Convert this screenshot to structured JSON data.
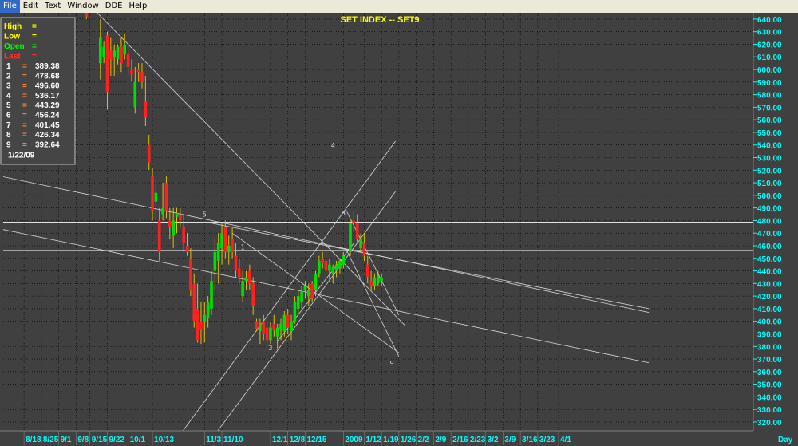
{
  "menu": [
    "File",
    "Edit",
    "Text",
    "Window",
    "DDE",
    "Help"
  ],
  "chart_data": {
    "type": "candlestick",
    "title": "SET  INDEX  --  SET9",
    "info_panel": {
      "rows": [
        {
          "label": "High",
          "sep": "=",
          "value": ""
        },
        {
          "label": "Low",
          "sep": "=",
          "value": ""
        },
        {
          "label": "Open",
          "sep": "=",
          "value": ""
        },
        {
          "label": "Last",
          "sep": "=",
          "value": ""
        }
      ],
      "levels": [
        {
          "n": "1",
          "sep": "=",
          "value": "389.38"
        },
        {
          "n": "2",
          "sep": "=",
          "value": "478.68"
        },
        {
          "n": "3",
          "sep": "=",
          "value": "496.60"
        },
        {
          "n": "4",
          "sep": "=",
          "value": "536.17"
        },
        {
          "n": "5",
          "sep": "=",
          "value": "443.29"
        },
        {
          "n": "6",
          "sep": "=",
          "value": "456.24"
        },
        {
          "n": "7",
          "sep": "=",
          "value": "401.45"
        },
        {
          "n": "8",
          "sep": "=",
          "value": "426.34"
        },
        {
          "n": "9",
          "sep": "=",
          "value": "392.64"
        }
      ],
      "date": "1/22/09"
    },
    "yaxis": {
      "min": 313,
      "max": 645,
      "ticks": [
        320,
        330,
        340,
        350,
        360,
        370,
        380,
        390,
        400,
        410,
        420,
        430,
        440,
        450,
        460,
        470,
        480,
        490,
        500,
        510,
        520,
        530,
        540,
        550,
        560,
        570,
        580,
        590,
        600,
        610,
        620,
        630,
        640
      ]
    },
    "xaxis_label": "Day",
    "xticks": [
      {
        "label": "8/18",
        "i": 0
      },
      {
        "label": "8/25",
        "i": 5
      },
      {
        "label": "9/1",
        "i": 10
      },
      {
        "label": "9/8",
        "i": 15
      },
      {
        "label": "9/15",
        "i": 19
      },
      {
        "label": "9/22",
        "i": 24
      },
      {
        "label": "10/1",
        "i": 30
      },
      {
        "label": "10/13",
        "i": 37
      },
      {
        "label": "11/3",
        "i": 52
      },
      {
        "label": "11/10",
        "i": 57
      },
      {
        "label": "12/1",
        "i": 71
      },
      {
        "label": "12/8",
        "i": 76
      },
      {
        "label": "12/15",
        "i": 81
      },
      {
        "label": "2009",
        "i": 92
      },
      {
        "label": "1/12",
        "i": 98
      },
      {
        "label": "1/19",
        "i": 103
      },
      {
        "label": "1/26",
        "i": 108
      },
      {
        "label": "2/2",
        "i": 113
      },
      {
        "label": "2/9",
        "i": 118
      },
      {
        "label": "2/16",
        "i": 123
      },
      {
        "label": "2/23",
        "i": 128
      },
      {
        "label": "3/2",
        "i": 133
      },
      {
        "label": "3/9",
        "i": 138
      },
      {
        "label": "3/16",
        "i": 143
      },
      {
        "label": "3/23",
        "i": 148
      },
      {
        "label": "4/1",
        "i": 154
      }
    ],
    "candles": [
      {
        "i": 12,
        "o": 649,
        "h": 651,
        "l": 645,
        "c": 647
      },
      {
        "i": 13,
        "o": 645,
        "h": 650,
        "l": 643,
        "c": 648
      },
      {
        "i": 18,
        "o": 652,
        "h": 656,
        "l": 640,
        "c": 642
      },
      {
        "i": 22,
        "o": 605,
        "h": 640,
        "l": 592,
        "c": 625
      },
      {
        "i": 23,
        "o": 610,
        "h": 622,
        "l": 605,
        "c": 618
      },
      {
        "i": 24,
        "o": 627,
        "h": 630,
        "l": 568,
        "c": 582
      },
      {
        "i": 25,
        "o": 615,
        "h": 625,
        "l": 595,
        "c": 608
      },
      {
        "i": 26,
        "o": 610,
        "h": 620,
        "l": 595,
        "c": 615
      },
      {
        "i": 27,
        "o": 608,
        "h": 620,
        "l": 604,
        "c": 618
      },
      {
        "i": 28,
        "o": 618,
        "h": 625,
        "l": 598,
        "c": 605
      },
      {
        "i": 29,
        "o": 612,
        "h": 628,
        "l": 608,
        "c": 620
      },
      {
        "i": 30,
        "o": 612,
        "h": 620,
        "l": 595,
        "c": 602
      },
      {
        "i": 31,
        "o": 600,
        "h": 608,
        "l": 590,
        "c": 596
      },
      {
        "i": 32,
        "o": 570,
        "h": 602,
        "l": 565,
        "c": 590
      },
      {
        "i": 33,
        "o": 600,
        "h": 605,
        "l": 590,
        "c": 598
      },
      {
        "i": 34,
        "o": 598,
        "h": 605,
        "l": 585,
        "c": 590
      },
      {
        "i": 35,
        "o": 575,
        "h": 595,
        "l": 555,
        "c": 562
      },
      {
        "i": 36,
        "o": 540,
        "h": 548,
        "l": 520,
        "c": 526
      },
      {
        "i": 37,
        "o": 515,
        "h": 522,
        "l": 480,
        "c": 487
      },
      {
        "i": 38,
        "o": 495,
        "h": 512,
        "l": 478,
        "c": 502
      },
      {
        "i": 39,
        "o": 480,
        "h": 490,
        "l": 448,
        "c": 455
      },
      {
        "i": 40,
        "o": 485,
        "h": 510,
        "l": 480,
        "c": 490
      },
      {
        "i": 41,
        "o": 510,
        "h": 515,
        "l": 482,
        "c": 488
      },
      {
        "i": 42,
        "o": 480,
        "h": 490,
        "l": 465,
        "c": 475
      },
      {
        "i": 43,
        "o": 468,
        "h": 490,
        "l": 458,
        "c": 480
      },
      {
        "i": 44,
        "o": 483,
        "h": 490,
        "l": 470,
        "c": 486
      },
      {
        "i": 45,
        "o": 485,
        "h": 490,
        "l": 475,
        "c": 480
      },
      {
        "i": 46,
        "o": 475,
        "h": 485,
        "l": 455,
        "c": 462
      },
      {
        "i": 47,
        "o": 460,
        "h": 470,
        "l": 452,
        "c": 455
      },
      {
        "i": 48,
        "o": 450,
        "h": 458,
        "l": 420,
        "c": 425
      },
      {
        "i": 49,
        "o": 430,
        "h": 438,
        "l": 395,
        "c": 400
      },
      {
        "i": 50,
        "o": 410,
        "h": 430,
        "l": 383,
        "c": 385
      },
      {
        "i": 51,
        "o": 400,
        "h": 415,
        "l": 382,
        "c": 393
      },
      {
        "i": 52,
        "o": 400,
        "h": 415,
        "l": 383,
        "c": 405
      },
      {
        "i": 53,
        "o": 403,
        "h": 420,
        "l": 395,
        "c": 415
      },
      {
        "i": 54,
        "o": 410,
        "h": 440,
        "l": 405,
        "c": 432
      },
      {
        "i": 55,
        "o": 440,
        "h": 465,
        "l": 425,
        "c": 455
      },
      {
        "i": 56,
        "o": 448,
        "h": 470,
        "l": 430,
        "c": 462
      },
      {
        "i": 57,
        "o": 458,
        "h": 478,
        "l": 445,
        "c": 470
      },
      {
        "i": 58,
        "o": 475,
        "h": 480,
        "l": 450,
        "c": 455
      },
      {
        "i": 59,
        "o": 455,
        "h": 468,
        "l": 445,
        "c": 460
      },
      {
        "i": 60,
        "o": 465,
        "h": 475,
        "l": 450,
        "c": 455
      },
      {
        "i": 61,
        "o": 452,
        "h": 462,
        "l": 435,
        "c": 440
      },
      {
        "i": 62,
        "o": 442,
        "h": 450,
        "l": 430,
        "c": 435
      },
      {
        "i": 63,
        "o": 420,
        "h": 440,
        "l": 415,
        "c": 432
      },
      {
        "i": 64,
        "o": 432,
        "h": 440,
        "l": 425,
        "c": 435
      },
      {
        "i": 65,
        "o": 440,
        "h": 445,
        "l": 425,
        "c": 430
      },
      {
        "i": 66,
        "o": 430,
        "h": 435,
        "l": 405,
        "c": 412
      },
      {
        "i": 67,
        "o": 400,
        "h": 402,
        "l": 392,
        "c": 394
      },
      {
        "i": 68,
        "o": 392,
        "h": 402,
        "l": 382,
        "c": 398
      },
      {
        "i": 69,
        "o": 400,
        "h": 405,
        "l": 385,
        "c": 390
      },
      {
        "i": 70,
        "o": 395,
        "h": 400,
        "l": 380,
        "c": 385
      },
      {
        "i": 71,
        "o": 385,
        "h": 400,
        "l": 382,
        "c": 395
      },
      {
        "i": 72,
        "o": 398,
        "h": 405,
        "l": 388,
        "c": 393
      },
      {
        "i": 73,
        "o": 388,
        "h": 398,
        "l": 378,
        "c": 395
      },
      {
        "i": 74,
        "o": 393,
        "h": 402,
        "l": 385,
        "c": 398
      },
      {
        "i": 75,
        "o": 392,
        "h": 408,
        "l": 388,
        "c": 405
      },
      {
        "i": 76,
        "o": 405,
        "h": 410,
        "l": 390,
        "c": 395
      },
      {
        "i": 77,
        "o": 392,
        "h": 405,
        "l": 385,
        "c": 400
      },
      {
        "i": 78,
        "o": 400,
        "h": 420,
        "l": 398,
        "c": 415
      },
      {
        "i": 79,
        "o": 410,
        "h": 425,
        "l": 405,
        "c": 420
      },
      {
        "i": 80,
        "o": 415,
        "h": 428,
        "l": 410,
        "c": 424
      },
      {
        "i": 81,
        "o": 425,
        "h": 432,
        "l": 418,
        "c": 428
      },
      {
        "i": 82,
        "o": 420,
        "h": 430,
        "l": 412,
        "c": 425
      },
      {
        "i": 83,
        "o": 430,
        "h": 432,
        "l": 415,
        "c": 418
      },
      {
        "i": 84,
        "o": 425,
        "h": 440,
        "l": 420,
        "c": 438
      },
      {
        "i": 85,
        "o": 438,
        "h": 452,
        "l": 435,
        "c": 448
      },
      {
        "i": 86,
        "o": 450,
        "h": 455,
        "l": 442,
        "c": 446
      },
      {
        "i": 87,
        "o": 448,
        "h": 456,
        "l": 438,
        "c": 440
      },
      {
        "i": 88,
        "o": 440,
        "h": 450,
        "l": 432,
        "c": 445
      },
      {
        "i": 89,
        "o": 438,
        "h": 445,
        "l": 430,
        "c": 443
      },
      {
        "i": 90,
        "o": 440,
        "h": 448,
        "l": 435,
        "c": 445
      },
      {
        "i": 91,
        "o": 442,
        "h": 450,
        "l": 438,
        "c": 448
      },
      {
        "i": 92,
        "o": 445,
        "h": 455,
        "l": 442,
        "c": 452
      },
      {
        "i": 94,
        "o": 455,
        "h": 480,
        "l": 452,
        "c": 478
      },
      {
        "i": 95,
        "o": 480,
        "h": 488,
        "l": 472,
        "c": 478
      },
      {
        "i": 96,
        "o": 478,
        "h": 485,
        "l": 462,
        "c": 465
      },
      {
        "i": 97,
        "o": 458,
        "h": 470,
        "l": 455,
        "c": 466
      },
      {
        "i": 98,
        "o": 462,
        "h": 470,
        "l": 448,
        "c": 452
      },
      {
        "i": 99,
        "o": 445,
        "h": 452,
        "l": 430,
        "c": 435
      },
      {
        "i": 100,
        "o": 432,
        "h": 440,
        "l": 425,
        "c": 428
      },
      {
        "i": 101,
        "o": 428,
        "h": 438,
        "l": 425,
        "c": 435
      },
      {
        "i": 102,
        "o": 430,
        "h": 440,
        "l": 428,
        "c": 436
      },
      {
        "i": 103,
        "o": 432,
        "h": 438,
        "l": 428,
        "c": 434
      }
    ],
    "lines": [
      {
        "i1": -15,
        "v1": 520,
        "i2": 180,
        "v2": 407
      },
      {
        "i1": -15,
        "v1": 478,
        "i2": 180,
        "v2": 367
      },
      {
        "i1": 20,
        "v1": 648,
        "i2": 110,
        "v2": 396
      },
      {
        "i1": 45,
        "v1": 310,
        "i2": 107,
        "v2": 543
      },
      {
        "i1": 55,
        "v1": 310,
        "i2": 107,
        "v2": 503
      },
      {
        "i1": 52,
        "v1": 479,
        "i2": 180,
        "v2": 410
      },
      {
        "i1": 73,
        "v1": 384,
        "i2": 95,
        "v2": 462
      },
      {
        "i1": 93,
        "v1": 487,
        "i2": 108,
        "v2": 405
      },
      {
        "i1": 60,
        "v1": 470,
        "i2": 108,
        "v2": 375
      },
      {
        "i1": 93,
        "v1": 456,
        "i2": 108,
        "v2": 372
      }
    ],
    "hlines": [
      478.68,
      456.24
    ],
    "cursor_index": 104,
    "markers": [
      {
        "t": "5",
        "i": 52,
        "v": 483
      },
      {
        "t": "4",
        "i": 89,
        "v": 538
      },
      {
        "t": "3",
        "i": 71,
        "v": 377
      },
      {
        "t": "8",
        "i": 92,
        "v": 484
      },
      {
        "t": "9",
        "i": 106,
        "v": 365
      },
      {
        "t": "1",
        "i": 63,
        "v": 457
      }
    ]
  }
}
